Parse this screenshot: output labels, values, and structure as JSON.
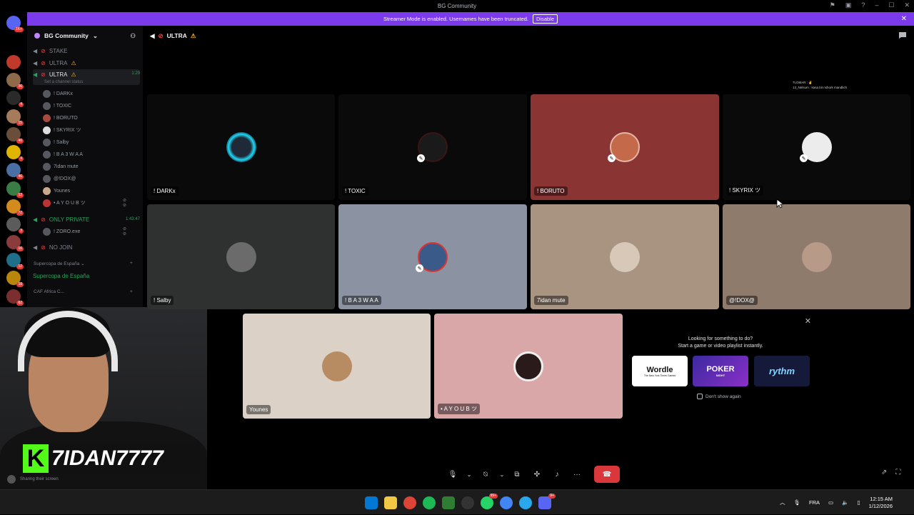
{
  "window": {
    "title": "BG Community"
  },
  "banner": {
    "text": "Streamer Mode is enabled. Usernames have been truncated.",
    "button": "Disable"
  },
  "server": {
    "name": "BG Community"
  },
  "rail_badges": [
    "1K+",
    "36",
    "4",
    "15",
    "40",
    "4",
    "46",
    "12",
    "72",
    "3",
    "16",
    "12",
    "18",
    "62",
    "21",
    "673",
    "NEW"
  ],
  "channels": {
    "stake": "STAKE",
    "ultra1": "ULTRA",
    "ultra_active": "ULTRA",
    "ultra_active_time": "1:29",
    "status_hint": "Set a channel status",
    "only_private": "ONLY PRIVATE",
    "only_private_time": "1:43:47",
    "no_join": "NO JOIN"
  },
  "voice_users": [
    "! DARKx",
    "! TOXIC",
    "! BORUTO",
    "! SKYRIX ツ",
    "! Salby",
    "! B A 3 W A A",
    "7idan mute",
    "@!DOX@",
    "Younes",
    "• A Y O U B ツ"
  ],
  "private_users": [
    "! ZORO.exe"
  ],
  "categories": {
    "supercopa": "Supercopa de España",
    "supercopa_channel": "Supercopa de España",
    "caf": "CAF Africa C..."
  },
  "call": {
    "channel": "ULTRA",
    "overlay_lines": [
      "7LOMAR : ✌",
      "13_Nelsum : kasa bit nshork mandlich"
    ]
  },
  "tiles": [
    {
      "name": "! DARKx"
    },
    {
      "name": "! TOXIC"
    },
    {
      "name": "! BORUTO"
    },
    {
      "name": "! SKYRIX ツ"
    },
    {
      "name": "! Salby"
    },
    {
      "name": "! B A 3 W A A"
    },
    {
      "name": "7idan mute"
    },
    {
      "name": "@!DOX@"
    },
    {
      "name": "Younes"
    },
    {
      "name": "• A Y O U B ツ"
    }
  ],
  "activity": {
    "title_line1": "Looking for something to do?",
    "title_line2": "Start a game or video playlist instantly.",
    "cards": [
      "Wordle",
      "POKER",
      "rythm"
    ],
    "wordle_sub": "The New York Times Games",
    "poker_sub": "NIGHT",
    "dont_show": "Don't show again"
  },
  "streamer": {
    "channel_name": "7IDAN7777",
    "kick_letter": "K"
  },
  "user_panel": {
    "status": "Sharing their screen"
  },
  "taskbar": {
    "lang": "FRA",
    "time": "12:15 AM",
    "date": "1/12/2026",
    "badge_whatsapp": "99+",
    "badge_discord": "9+"
  },
  "colors": {
    "accent": "#7c3aed",
    "hangup": "#da373c",
    "kick_green": "#53fc18",
    "voice_green": "#23a55a"
  }
}
